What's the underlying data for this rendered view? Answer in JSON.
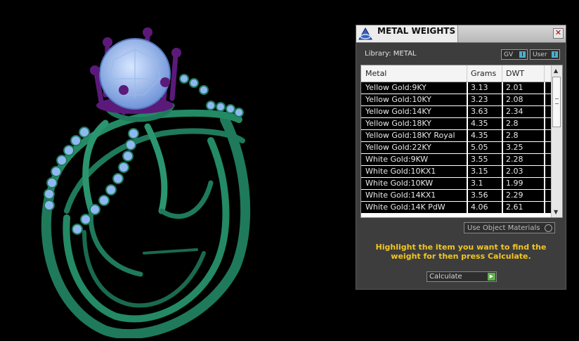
{
  "panel": {
    "title": "METAL WEIGHTS",
    "close_label": "✕",
    "library_label": "Library: METAL",
    "toggles": [
      {
        "label": "GV",
        "knob": "I"
      },
      {
        "label": "User",
        "knob": "I"
      }
    ],
    "columns": [
      "Metal",
      "Grams",
      "DWT"
    ],
    "rows": [
      {
        "metal": "Yellow Gold:9KY",
        "grams": "3.13",
        "dwt": "2.01"
      },
      {
        "metal": "Yellow Gold:10KY",
        "grams": "3.23",
        "dwt": "2.08"
      },
      {
        "metal": "Yellow Gold:14KY",
        "grams": "3.63",
        "dwt": "2.34"
      },
      {
        "metal": "Yellow Gold:18KY",
        "grams": "4.35",
        "dwt": "2.8"
      },
      {
        "metal": "Yellow Gold:18KY Royal",
        "grams": "4.35",
        "dwt": "2.8"
      },
      {
        "metal": "Yellow Gold:22KY",
        "grams": "5.05",
        "dwt": "3.25"
      },
      {
        "metal": "White Gold:9KW",
        "grams": "3.55",
        "dwt": "2.28"
      },
      {
        "metal": "White Gold:10KX1",
        "grams": "3.15",
        "dwt": "2.03"
      },
      {
        "metal": "White Gold:10KW",
        "grams": "3.1",
        "dwt": "1.99"
      },
      {
        "metal": "White Gold:14KX1",
        "grams": "3.56",
        "dwt": "2.29"
      },
      {
        "metal": "White Gold:14K PdW",
        "grams": "4.06",
        "dwt": "2.61"
      }
    ],
    "use_object_materials": "Use Object Materials",
    "instruction": "Highlight the item you want to find the weight for then press Calculate.",
    "calculate_label": "Calculate",
    "icons": {
      "app": "ring-app-icon",
      "calculate": "go-arrow-icon"
    }
  },
  "colors": {
    "ring_metal": "#1e7a5a",
    "prongs": "#5b1a7a",
    "stones": "#8fb8f2",
    "instruction_text": "#f2c622",
    "toggle_knob": "#4bb0c8"
  }
}
